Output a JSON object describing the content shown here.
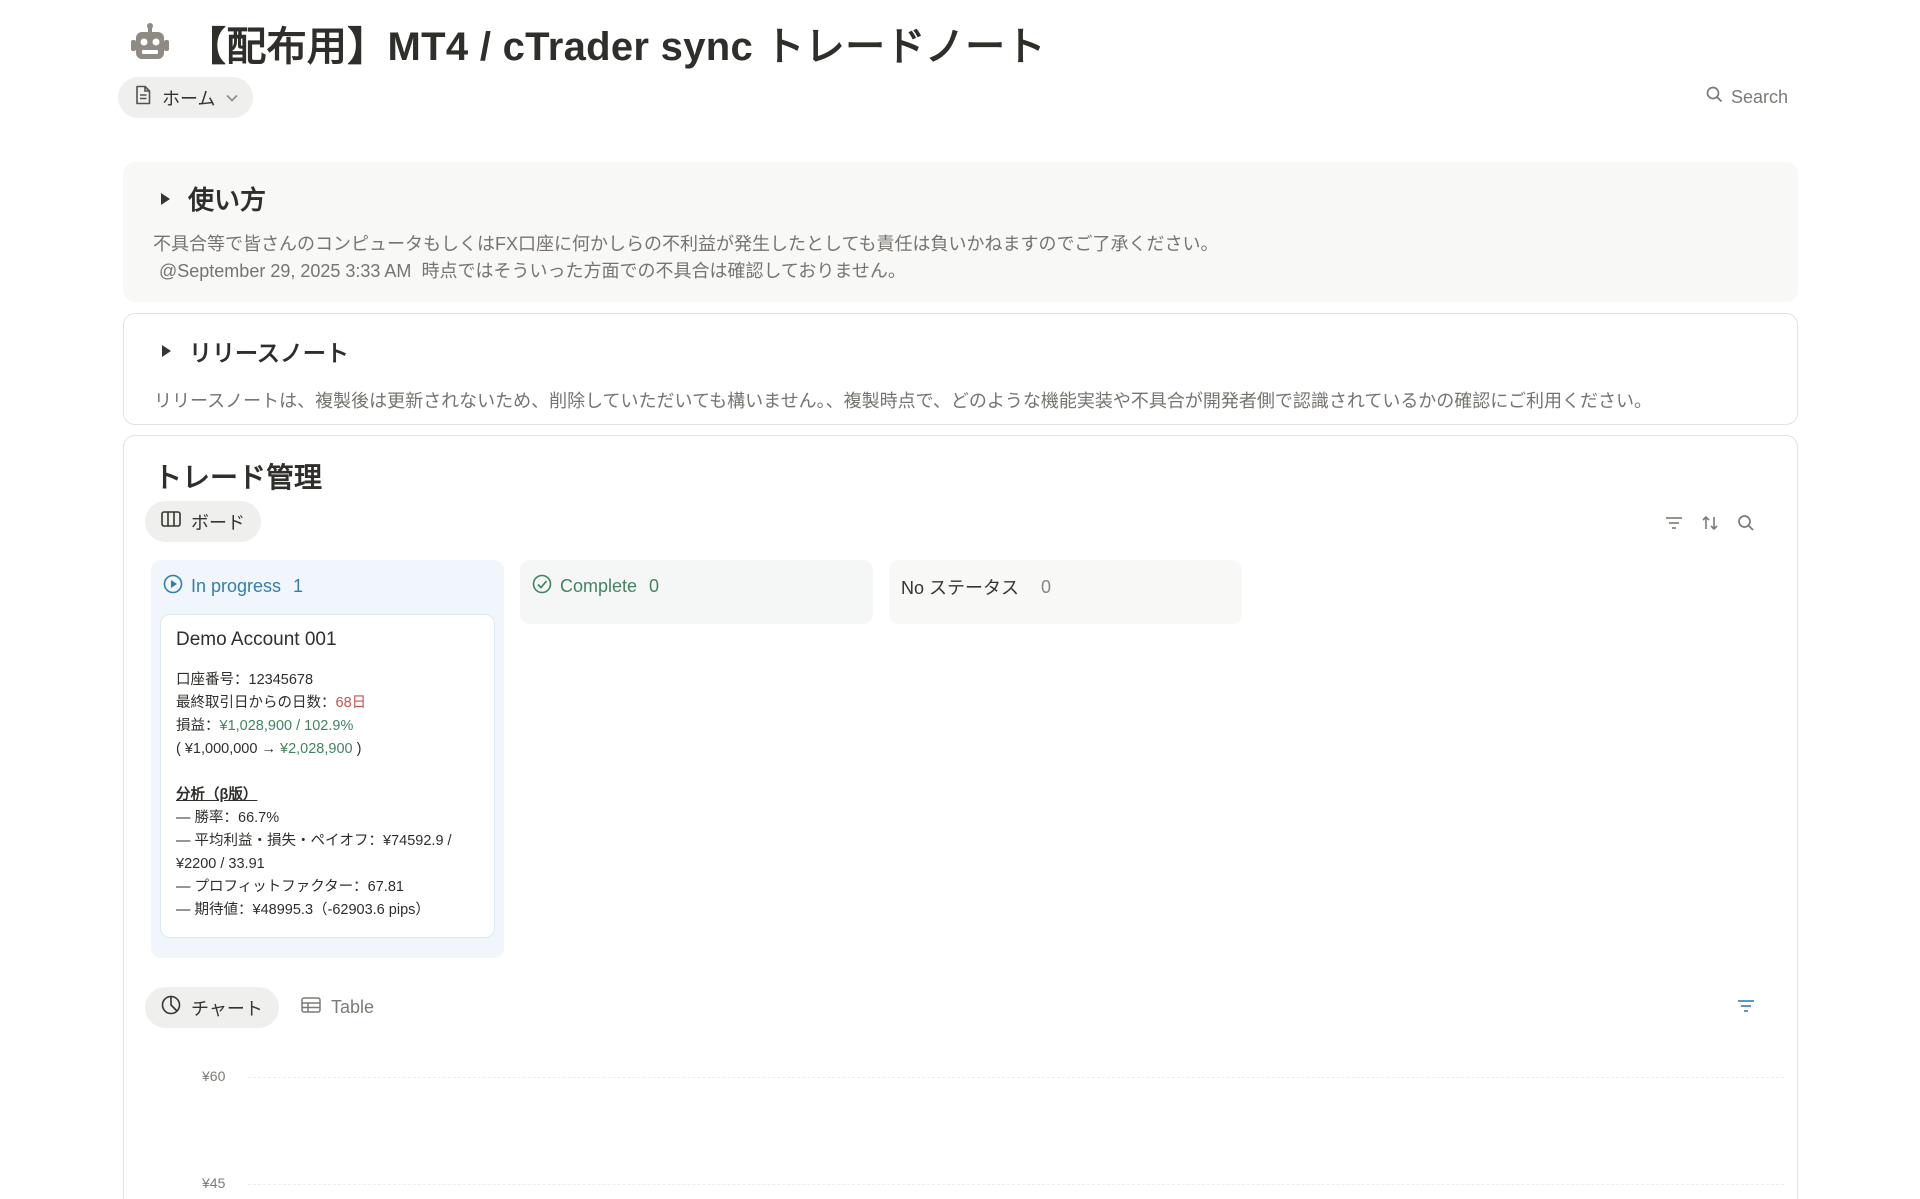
{
  "page": {
    "icon": "robot-icon",
    "title": "【配布用】MT4 / cTrader sync トレードノート",
    "view_label": "ホーム",
    "search_label": "Search"
  },
  "usage": {
    "title": "使い方",
    "line1": "不具合等で皆さんのコンピュータもしくはFX口座に何かしらの不利益が発生したとしても責任は負いかねますのでご了承ください。",
    "mention": "@September 29, 2025 3:33 AM",
    "line2": "時点ではそういった方面での不具合は確認しておりません。"
  },
  "release": {
    "title": "リリースノート",
    "text": "リリースノートは、複製後は更新されないため、削除していただいても構いません。、複製時点で、どのような機能実装や不具合が開発者側で認識されているかの確認にご利用ください。"
  },
  "trade": {
    "title": "トレード管理",
    "board_tab": "ボード",
    "columns": [
      {
        "label": "In progress",
        "count": "1",
        "color": "#347ea9"
      },
      {
        "label": "Complete",
        "count": "0",
        "color": "#448361"
      },
      {
        "label": "No ステータス",
        "count": "0",
        "color": "#37352f"
      }
    ],
    "card": {
      "title": "Demo Account 001",
      "account_label": "口座番号：",
      "account_number": "12345678",
      "days_label": "最終取引日からの日数：",
      "days_value": "68日",
      "pl_label": "損益：",
      "pl_value": "¥1,028,900 / 102.9%",
      "balance_open": "( ¥1,000,000 → ",
      "balance_to": "¥2,028,900",
      "balance_close": " )",
      "analysis_title": "分析（β版）",
      "winrate": "― 勝率：66.7%",
      "avg": "― 平均利益・損失・ペイオフ：¥74592.9 / ¥2200 / 33.91",
      "pf": "― プロフィットファクター：67.81",
      "expectancy": "― 期待値：¥48995.3（-62903.6 pips）"
    },
    "chart_tab": "チャート",
    "table_tab": "Table",
    "chart_axis_ticks": [
      "¥60",
      "¥45"
    ]
  }
}
